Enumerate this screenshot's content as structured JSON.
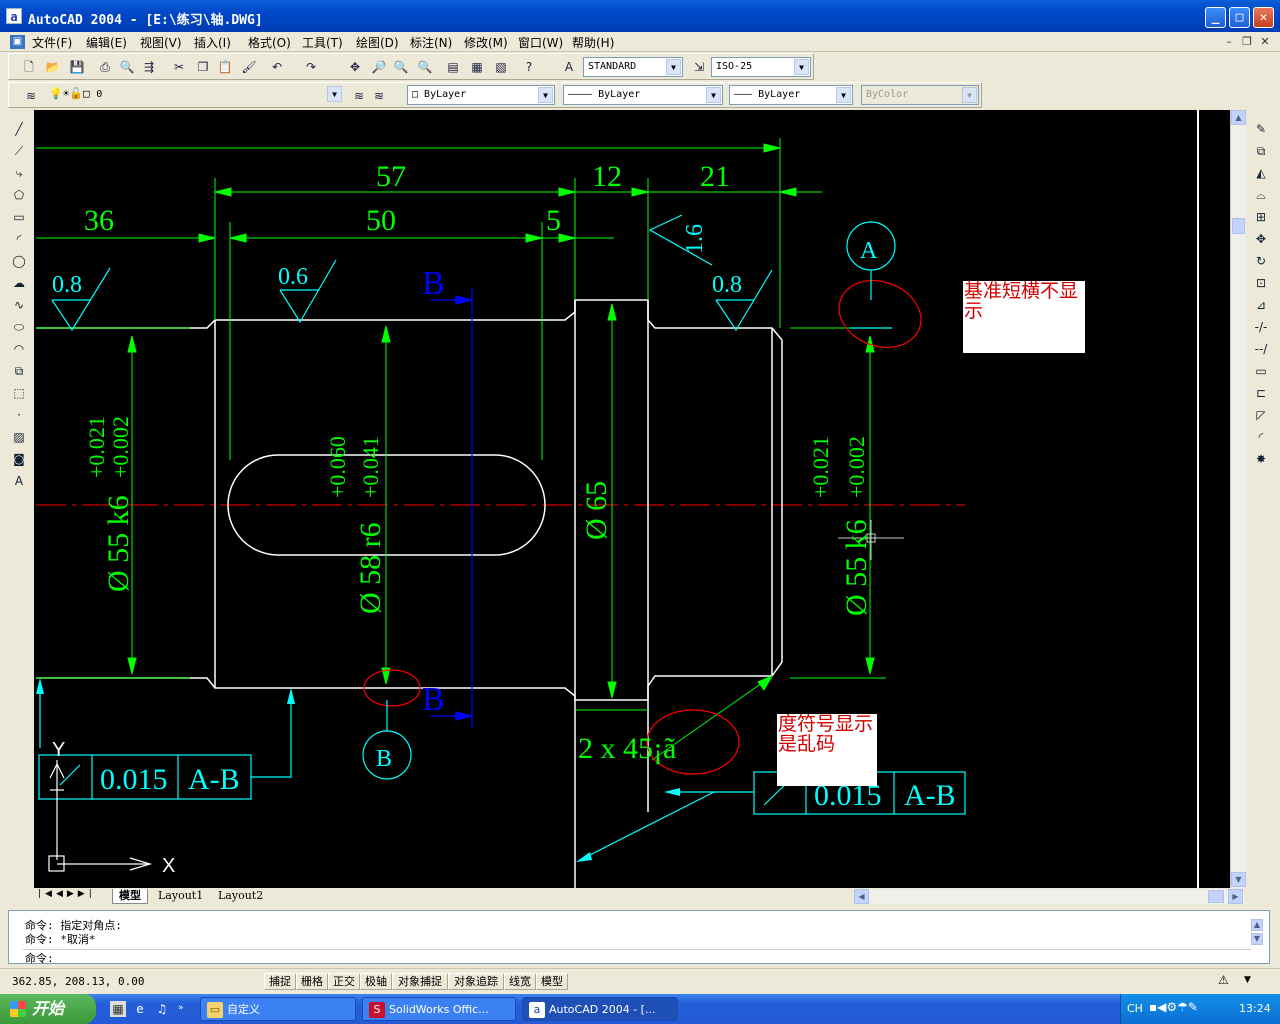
{
  "window": {
    "title": "AutoCAD 2004 - [E:\\练习\\轴.DWG]",
    "min": "_",
    "max": "□",
    "close": "✕",
    "app_icon": "a"
  },
  "menu": {
    "items": [
      "文件(F)",
      "编辑(E)",
      "视图(V)",
      "插入(I)",
      "格式(O)",
      "工具(T)",
      "绘图(D)",
      "标注(N)",
      "修改(M)",
      "窗口(W)",
      "帮助(H)"
    ],
    "mdi_min": "–",
    "mdi_restore": "❐",
    "mdi_close": "✕"
  },
  "toolbar": {
    "text_style": "STANDARD",
    "dim_style": "ISO-25",
    "layer": "0",
    "color": "ByLayer",
    "linetype": "ByLayer",
    "lineweight": "ByLayer",
    "plotstyle": "ByColor"
  },
  "drawing": {
    "dims": {
      "d57": "57",
      "d12": "12",
      "d21": "21",
      "d36": "36",
      "d50": "50",
      "d5": "5",
      "r16": "1.6",
      "r08a": "0.8",
      "r06": "0.6",
      "r08b": "0.8",
      "dia55a": "Ø 55 k6",
      "tol55a_up": "+0.021",
      "tol55a_lo": "+0.002",
      "dia58": "Ø 58 r6",
      "tol58_up": "+0.060",
      "tol58_lo": "+0.041",
      "dia65": "Ø 65",
      "dia55b": "Ø 55 k6",
      "tol55b_up": "+0.021",
      "tol55b_lo": "+0.002",
      "chamfer": "2 x 45¡ã",
      "datum_a": "A",
      "datum_b": "B",
      "sec_b1": "B",
      "sec_b2": "B",
      "fcf1_tol": "0.015",
      "fcf1_ref": "A-B",
      "fcf2_tol": "0.015",
      "fcf2_ref": "A-B",
      "ucs_y": "Y",
      "ucs_x": "X"
    },
    "note1": "基准短横不显示",
    "note2": "度符号显示是乱码"
  },
  "tabs": {
    "model": "模型",
    "layout1": "Layout1",
    "layout2": "Layout2"
  },
  "command": {
    "line1": "命令: 指定对角点:",
    "line2": "命令: *取消*",
    "line3": "命令:"
  },
  "status": {
    "coords": "362.85, 208.13, 0.00",
    "buttons": [
      "捕捉",
      "栅格",
      "正交",
      "极轴",
      "对象捕捉",
      "对象追踪",
      "线宽",
      "模型"
    ]
  },
  "taskbar": {
    "start": "开始",
    "tasks": [
      "自定义",
      "SolidWorks Offic...",
      "AutoCAD 2004 - [..."
    ],
    "ime": "CH",
    "time": "13:24"
  },
  "colors": {
    "dim_green": "#00ff00",
    "cyan": "#00ffff",
    "red": "#ff0000",
    "blue": "#0000ff",
    "white": "#ffffff",
    "canvas_bg": "#000000"
  }
}
